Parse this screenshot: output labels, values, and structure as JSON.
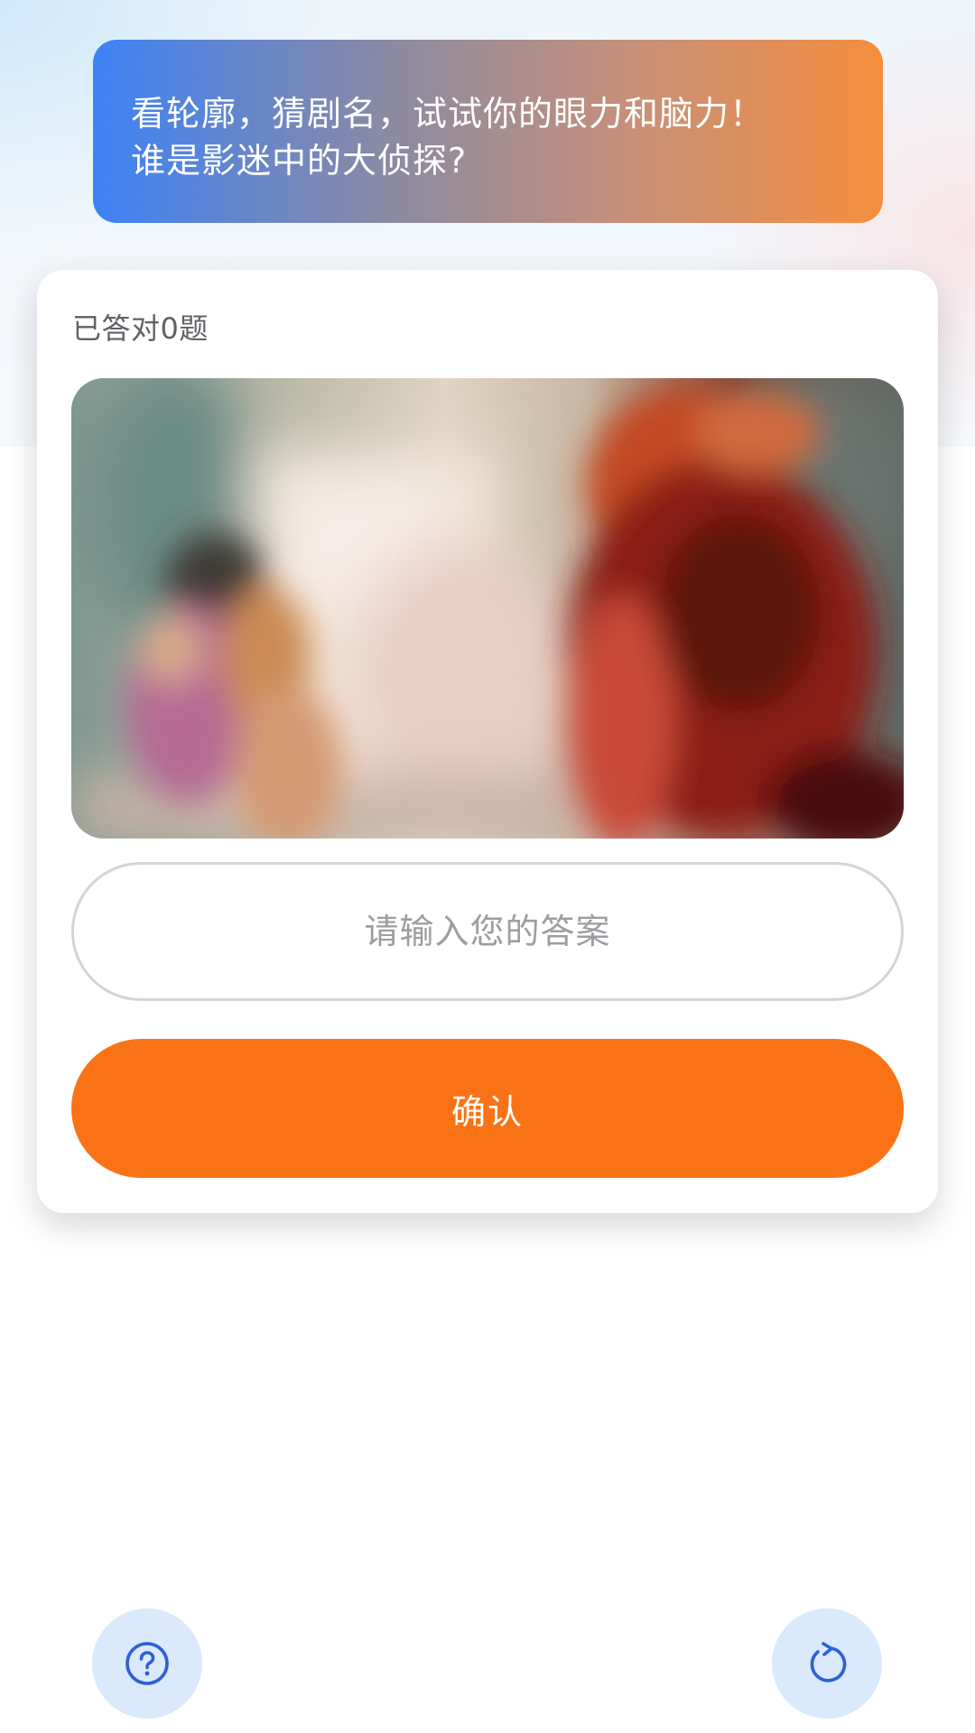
{
  "banner": {
    "line1": "看轮廓，猜剧名，试试你的眼力和脑力！",
    "line2": "谁是影迷中的大侦探?"
  },
  "card": {
    "score_text": "已答对0题",
    "answer_placeholder": "请输入您的答案",
    "answer_value": "",
    "confirm_label": "确认"
  },
  "icons": {
    "help": "question-circle-icon",
    "refresh": "refresh-icon"
  },
  "colors": {
    "accent": "#f97316",
    "icon_blue": "#2f5fd6",
    "icon_bg": "#dbe9fc",
    "banner_start": "#3d82f6",
    "banner_end": "#f58e3d"
  }
}
